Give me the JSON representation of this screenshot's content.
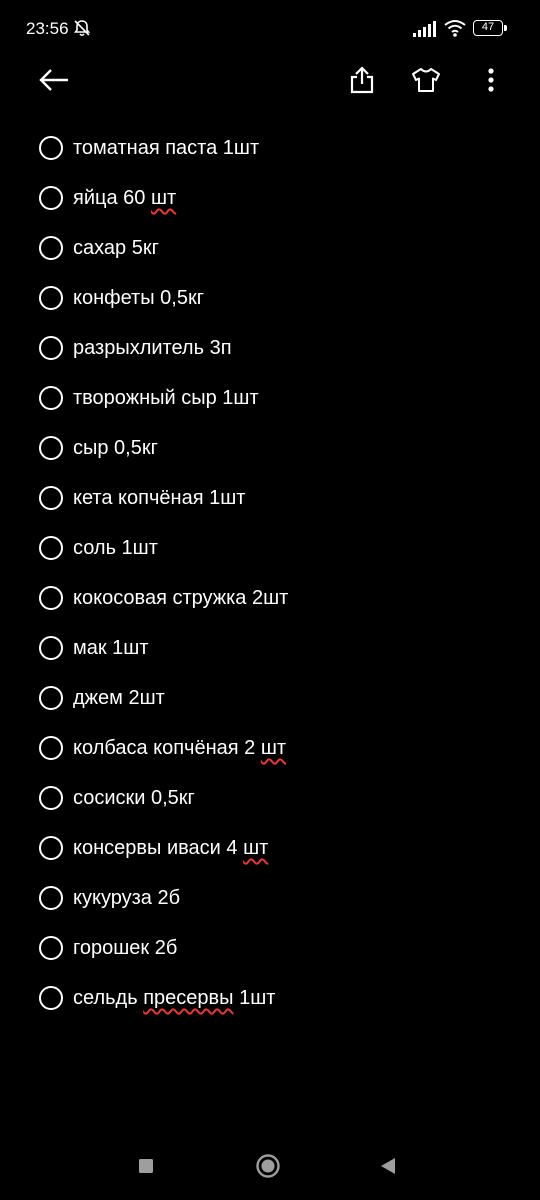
{
  "status_bar": {
    "time": "23:56",
    "battery": "47"
  },
  "toolbar": {
    "back_icon": "arrow-left-icon",
    "share_icon": "share-icon",
    "theme_icon": "tshirt-icon",
    "more_icon": "more-vert-icon"
  },
  "items": [
    {
      "parts": [
        "томатная паста 1шт"
      ]
    },
    {
      "parts": [
        "яйца 60 ",
        "шт"
      ]
    },
    {
      "parts": [
        "сахар 5кг"
      ]
    },
    {
      "parts": [
        "конфеты 0,5кг"
      ]
    },
    {
      "parts": [
        "разрыхлитель 3п"
      ]
    },
    {
      "parts": [
        "творожный сыр 1шт"
      ]
    },
    {
      "parts": [
        "сыр 0,5кг"
      ]
    },
    {
      "parts": [
        "кета копчёная 1шт"
      ]
    },
    {
      "parts": [
        "соль 1шт"
      ]
    },
    {
      "parts": [
        "кокосовая стружка 2шт"
      ]
    },
    {
      "parts": [
        "мак 1шт"
      ]
    },
    {
      "parts": [
        "джем 2шт"
      ]
    },
    {
      "parts": [
        "колбаса копчёная 2 ",
        "шт"
      ]
    },
    {
      "parts": [
        "сосиски 0,5кг"
      ]
    },
    {
      "parts": [
        "консервы иваси 4 ",
        "шт"
      ]
    },
    {
      "parts": [
        "кукуруза 2б"
      ]
    },
    {
      "parts": [
        "горошек 2б"
      ]
    },
    {
      "parts": [
        "сельдь ",
        "пресервы",
        " 1шт"
      ]
    }
  ],
  "nav_bar": {
    "recent_icon": "square-icon",
    "home_icon": "circle-icon",
    "back_icon": "triangle-back-icon"
  }
}
